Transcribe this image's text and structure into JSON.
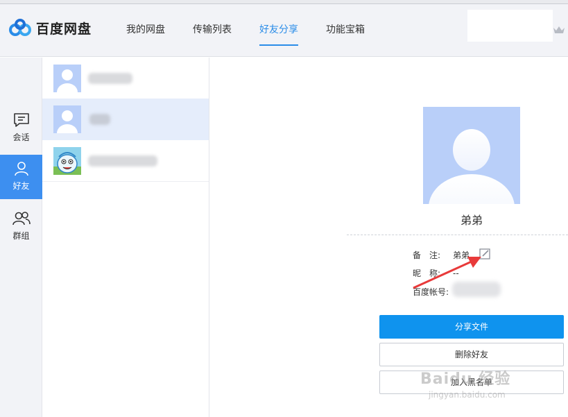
{
  "app": {
    "name": "百度网盘"
  },
  "nav": {
    "items": [
      {
        "label": "我的网盘",
        "active": false
      },
      {
        "label": "传输列表",
        "active": false
      },
      {
        "label": "好友分享",
        "active": true
      },
      {
        "label": "功能宝箱",
        "active": false
      }
    ]
  },
  "sidebar": {
    "items": [
      {
        "label": "会话",
        "icon": "chat-icon",
        "active": false
      },
      {
        "label": "好友",
        "icon": "person-icon",
        "active": true
      },
      {
        "label": "群组",
        "icon": "group-icon",
        "active": false
      }
    ]
  },
  "friends": {
    "items": [
      {
        "name": "",
        "avatar": "default-avatar",
        "selected": false
      },
      {
        "name": "",
        "avatar": "default-avatar",
        "selected": true
      },
      {
        "name": "",
        "avatar": "cartoon-avatar",
        "selected": false
      }
    ]
  },
  "detail": {
    "name": "弟弟",
    "remark_label": "备　注:",
    "remark_value": "弟弟",
    "nickname_label": "昵　称:",
    "nickname_value": "--",
    "account_label": "百度帐号:",
    "account_value": "",
    "share_button": "分享文件",
    "delete_button": "删除好友",
    "blacklist_button": "加入黑名单"
  },
  "watermark": {
    "main": "Baidu 经验",
    "sub": "jingyan.baidu.com"
  },
  "colors": {
    "accent": "#2a8ce8",
    "sidebar_active": "#3d8ff0",
    "primary_button": "#0f93ee",
    "avatar_bg": "#b9cff9",
    "annotation": "#e83a3a"
  }
}
